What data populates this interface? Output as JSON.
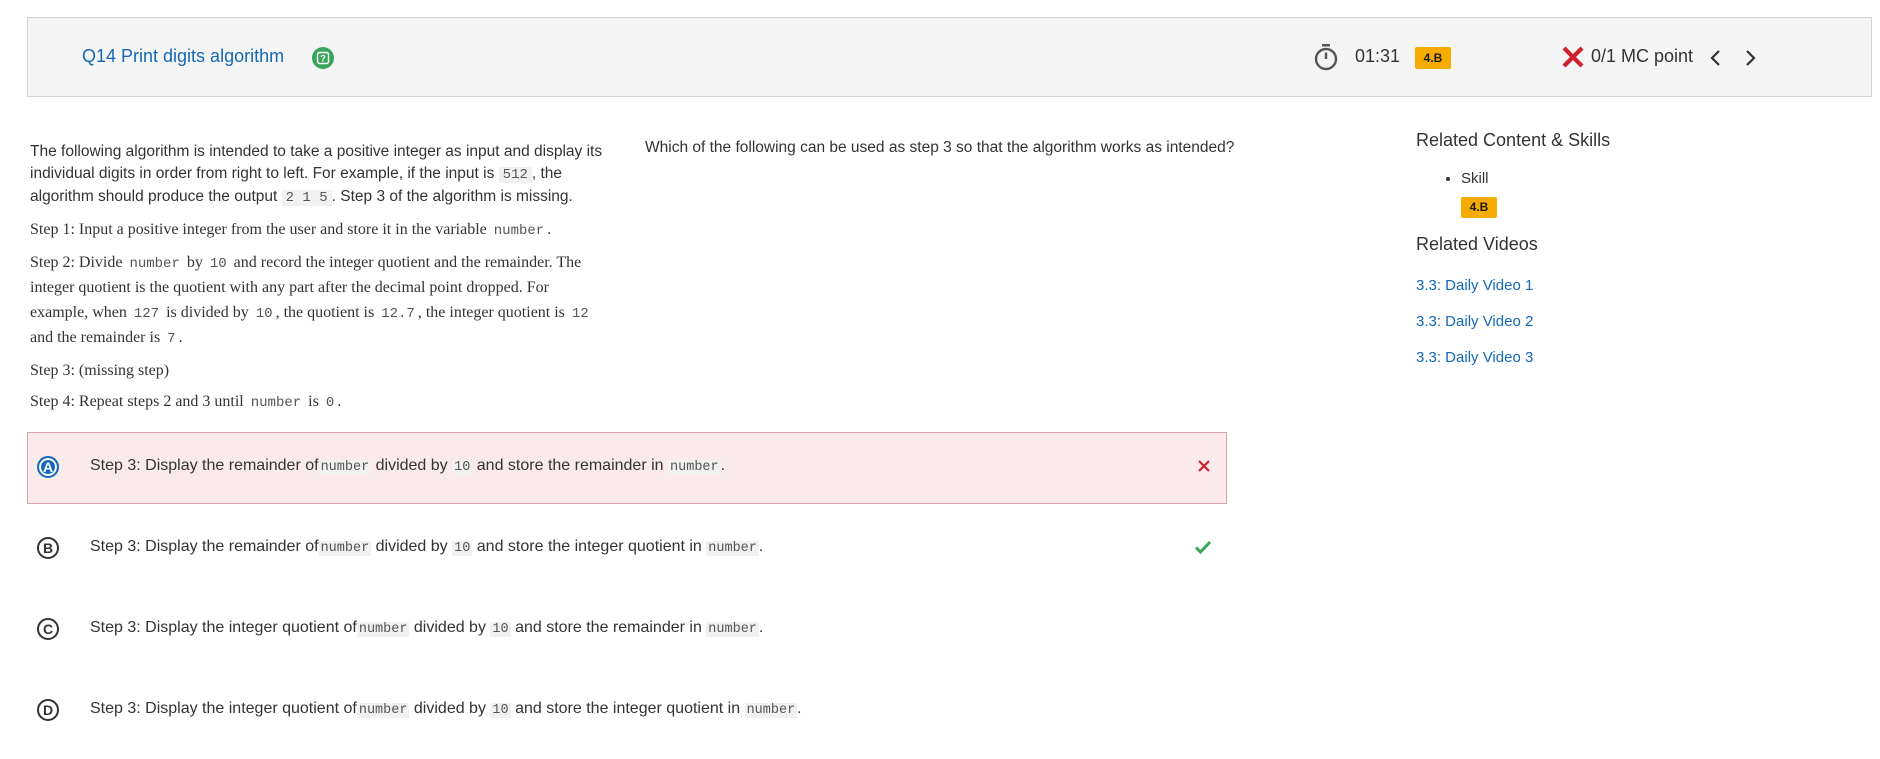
{
  "header": {
    "question_title": "Q14 Print digits algorithm",
    "timer": "01:31",
    "skill_badge": "4.B",
    "score": "0/1 MC point"
  },
  "stimulus": {
    "intro_part1": "The following algorithm is intended to take a positive integer as input and display its individual digits in order from right to left. For example, if the input is",
    "intro_code1": "512",
    "intro_part2": ", the algorithm should produce the output",
    "intro_code2": "2 1 5",
    "intro_part3": ". Step 3 of the algorithm is missing.",
    "step1_text": "Step 1: Input a positive integer from the user and store it in the variable",
    "step1_code": "number",
    "step2_a": "Step 2: Divide",
    "step2_code1": "number",
    "step2_b": "by",
    "step2_code2": "10",
    "step2_c": "and record the integer quotient and the remainder. The integer quotient is the quotient with any part after the decimal point dropped. For example, when",
    "step2_code3": "127",
    "step2_d": "is divided by",
    "step2_code4": "10",
    "step2_e": ", the quotient is",
    "step2_code5": "12.7",
    "step2_f": ", the integer quotient is",
    "step2_code6": "12",
    "step2_g": "and the remainder is",
    "step2_code7": "7",
    "step3_text": "Step 3: (missing step)",
    "step4_a": "Step 4: Repeat steps 2 and 3 until",
    "step4_code1": "number",
    "step4_b": "is",
    "step4_code2": "0"
  },
  "question": {
    "prompt": "Which of the following can be used as step 3 so that the algorithm works as intended?"
  },
  "choices": [
    {
      "letter": "A",
      "t1": "Step 3: Display the remainder of",
      "c1": "number",
      "t2": "divided by",
      "c2": "10",
      "t3": "and store the remainder in",
      "c3": "number",
      "t4": ".",
      "state": "selected-incorrect"
    },
    {
      "letter": "B",
      "t1": "Step 3: Display the remainder of",
      "c1": "number",
      "t2": "divided by",
      "c2": "10",
      "t3": "and store the integer quotient in",
      "c3": "number",
      "t4": ".",
      "state": "correct"
    },
    {
      "letter": "C",
      "t1": "Step 3: Display the integer quotient of",
      "c1": "number",
      "t2": "divided by",
      "c2": "10",
      "t3": "and store the remainder in",
      "c3": "number",
      "t4": ".",
      "state": "unselected"
    },
    {
      "letter": "D",
      "t1": "Step 3: Display the integer quotient of",
      "c1": "number",
      "t2": "divided by",
      "c2": "10",
      "t3": "and store the integer quotient in",
      "c3": "number",
      "t4": ".",
      "state": "unselected"
    }
  ],
  "sidebar": {
    "related_content_title": "Related Content & Skills",
    "skill_label": "Skill",
    "skill_badge": "4.B",
    "related_videos_title": "Related Videos",
    "videos": [
      "3.3: Daily Video 1",
      "3.3: Daily Video 2",
      "3.3: Daily Video 3"
    ]
  },
  "colors": {
    "accent_blue": "#1468b6",
    "badge_orange": "#f5ab00",
    "wrong_bg": "#fbeaec",
    "wrong_red": "#d0202e",
    "correct_green": "#3aa55a",
    "help_green": "#3aa55a"
  },
  "icons": {
    "help": "question-mark-icon",
    "timer": "stopwatch-icon",
    "score_status": "x-icon",
    "prev": "chevron-left-icon",
    "next": "chevron-right-icon",
    "incorrect": "x-icon",
    "correct": "check-icon"
  }
}
